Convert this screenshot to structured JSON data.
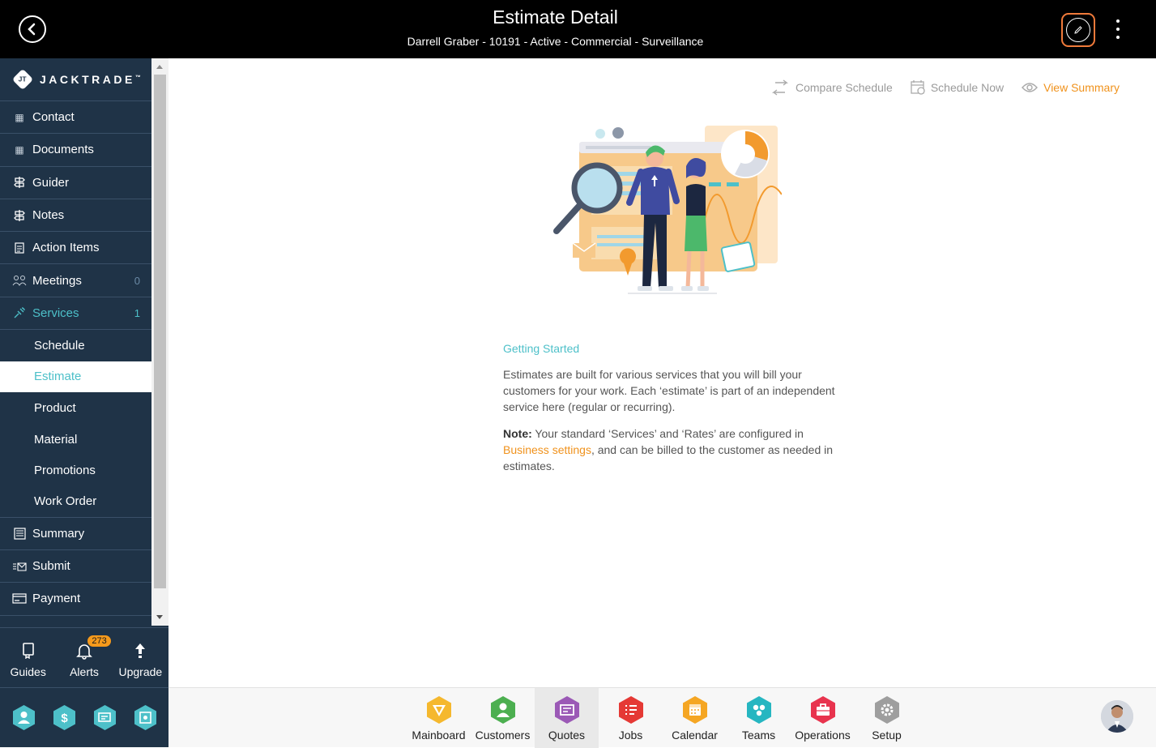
{
  "header": {
    "title": "Estimate Detail",
    "subtitle": "Darrell Graber - 10191 - Active - Commercial - Surveillance"
  },
  "brand": {
    "name": "JACKTRADE",
    "mark": "JT",
    "trademark": "™"
  },
  "sidebar": {
    "items": [
      {
        "label": "Contact",
        "icon": "address-book-icon"
      },
      {
        "label": "Documents",
        "icon": "document-icon"
      },
      {
        "label": "Guider",
        "icon": "signpost-icon"
      },
      {
        "label": "Notes",
        "icon": "signpost-icon"
      },
      {
        "label": "Action Items",
        "icon": "clipboard-icon"
      },
      {
        "label": "Meetings",
        "icon": "people-icon",
        "count": "0"
      },
      {
        "label": "Services",
        "icon": "services-icon",
        "count": "1"
      }
    ],
    "sub_items": [
      {
        "label": "Schedule"
      },
      {
        "label": "Estimate"
      },
      {
        "label": "Product"
      },
      {
        "label": "Material"
      },
      {
        "label": "Promotions"
      },
      {
        "label": "Work Order"
      }
    ],
    "lower_items": [
      {
        "label": "Summary",
        "icon": "list-icon"
      },
      {
        "label": "Submit",
        "icon": "submit-icon"
      },
      {
        "label": "Payment",
        "icon": "card-icon"
      }
    ],
    "bottom": [
      {
        "label": "Guides",
        "icon": "book-icon"
      },
      {
        "label": "Alerts",
        "icon": "bell-icon",
        "badge": "273"
      },
      {
        "label": "Upgrade",
        "icon": "arrow-up-icon"
      }
    ]
  },
  "actions": {
    "compare": "Compare Schedule",
    "schedule": "Schedule Now",
    "summary": "View Summary"
  },
  "content": {
    "heading": "Getting Started",
    "para1": "Estimates are built for various services that you will bill your customers for your work. Each ‘estimate’ is part of an independent service here (regular or recurring).",
    "note_label": "Note:",
    "note_text1": " Your standard ‘Services’ and ‘Rates’ are configured in ",
    "note_link": "Business settings",
    "note_text2": ", and can be billed to the customer as needed in estimates."
  },
  "dock": [
    {
      "label": "Mainboard",
      "color": "#f5b82e"
    },
    {
      "label": "Customers",
      "color": "#4caf50"
    },
    {
      "label": "Quotes",
      "color": "#9b59b6"
    },
    {
      "label": "Jobs",
      "color": "#e53935"
    },
    {
      "label": "Calendar",
      "color": "#f5a623"
    },
    {
      "label": "Teams",
      "color": "#26b6c1"
    },
    {
      "label": "Operations",
      "color": "#e8334e"
    },
    {
      "label": "Setup",
      "color": "#9e9e9e"
    }
  ],
  "colors": {
    "accent": "#f0921c",
    "teal": "#4dc0c9",
    "sidebar": "#1f3347",
    "edit_border": "#f07a3a"
  }
}
